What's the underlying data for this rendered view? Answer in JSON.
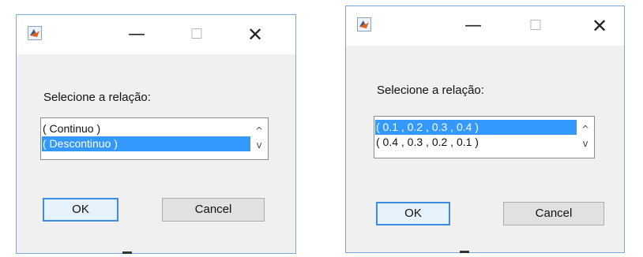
{
  "dialogs": [
    {
      "titlebar": {
        "minimize_glyph": "—",
        "maximize_glyph": "☐",
        "close_glyph": "✕",
        "icon": "matlab-logo-icon"
      },
      "prompt": "Selecione a relação:",
      "list": {
        "items": [
          "( Continuo )",
          "( Descontinuo )"
        ],
        "selected_index": 1
      },
      "scroll": {
        "up": "^",
        "down": "v"
      },
      "buttons": {
        "ok": "OK",
        "cancel": "Cancel"
      }
    },
    {
      "titlebar": {
        "minimize_glyph": "—",
        "maximize_glyph": "☐",
        "close_glyph": "✕",
        "icon": "matlab-logo-icon"
      },
      "prompt": "Selecione a relação:",
      "list": {
        "items": [
          "( 0.1 , 0.2 , 0.3 , 0.4 )",
          "( 0.4 , 0.3 , 0.2 , 0.1 )"
        ],
        "selected_index": 0
      },
      "scroll": {
        "up": "^",
        "down": "v"
      },
      "buttons": {
        "ok": "OK",
        "cancel": "Cancel"
      }
    }
  ],
  "colors": {
    "selection": "#3399ff",
    "default_button_border": "#3c8ce6",
    "dialog_bg": "#f0f0f0"
  }
}
